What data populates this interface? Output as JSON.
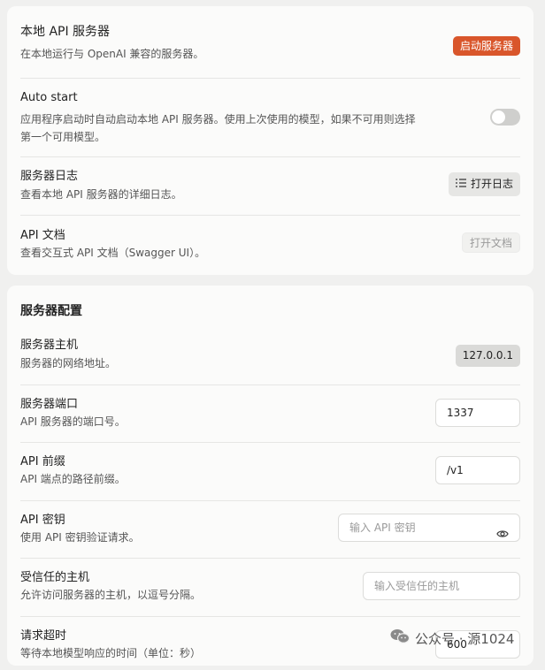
{
  "local_server": {
    "title": "本地 API 服务器",
    "description": "在本地运行与 OpenAI 兼容的服务器。",
    "start_button": "启动服务器"
  },
  "auto_start": {
    "title": "Auto start",
    "description_line1": "应用程序启动时自动启动本地 API 服务器。使用上次使用的模型，如果不可用则选择",
    "description_line2": "第一个可用模型。",
    "enabled": false
  },
  "server_logs": {
    "title": "服务器日志",
    "description": "查看本地 API 服务器的详细日志。",
    "button": "打开日志",
    "icon": "list-icon"
  },
  "api_docs": {
    "title": "API 文档",
    "description": "查看交互式 API 文档（Swagger UI）。",
    "button": "打开文档"
  },
  "server_config": {
    "title": "服务器配置",
    "host": {
      "title": "服务器主机",
      "description": "服务器的网络地址。",
      "value": "127.0.0.1"
    },
    "port": {
      "title": "服务器端口",
      "description": "API 服务器的端口号。",
      "value": "1337"
    },
    "prefix": {
      "title": "API 前缀",
      "description": "API 端点的路径前缀。",
      "value": "/v1"
    },
    "api_key": {
      "title": "API 密钥",
      "description": "使用 API 密钥验证请求。",
      "placeholder": "输入 API 密钥",
      "icon": "eye-icon"
    },
    "trusted_hosts": {
      "title": "受信任的主机",
      "description": "允许访问服务器的主机，以逗号分隔。",
      "placeholder": "输入受信任的主机"
    },
    "timeout": {
      "title": "请求超时",
      "description": "等待本地模型响应的时间（单位：秒）",
      "value": "600"
    }
  },
  "watermark": {
    "text": "公众号 · 源1024"
  },
  "colors": {
    "accent": "#d9562b",
    "background": "#f0f0ef",
    "card": "#fbfbfa"
  }
}
